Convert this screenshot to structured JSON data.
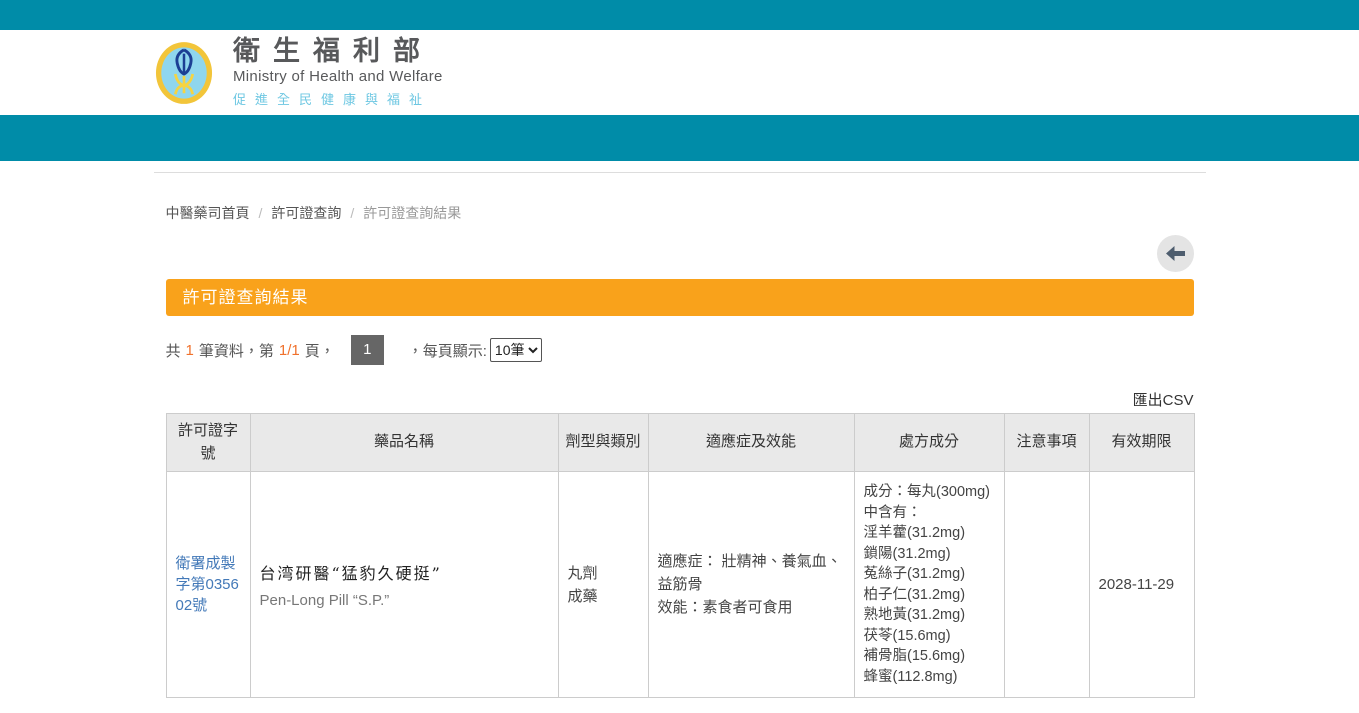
{
  "colors": {
    "teal": "#008CA8",
    "orange_bar": "#F9A21B",
    "accent_orange": "#F0712C",
    "link_blue": "#4379B8"
  },
  "header": {
    "title_zh": "衛生福利部",
    "title_en": "Ministry of Health and Welfare",
    "tagline": "促進全民健康與福祉"
  },
  "breadcrumb": {
    "separator": "/",
    "items": [
      {
        "label": "中醫藥司首頁"
      },
      {
        "label": "許可證查詢"
      },
      {
        "label": "許可證查詢結果"
      }
    ]
  },
  "page": {
    "section_title": "許可證查詢結果",
    "csv_label": "匯出CSV"
  },
  "pagination": {
    "prefix": "共",
    "total": "1",
    "mid1": "筆資料，第",
    "page_ratio": "1/1",
    "mid2": "頁，",
    "current_page": "1",
    "per_page_label": "，每頁顯示:",
    "per_page_value": "10筆"
  },
  "table": {
    "headers": {
      "license": "許可證字號",
      "drug_name": "藥品名稱",
      "dosage_type": "劑型與類別",
      "indications": "適應症及效能",
      "ingredients": "處方成分",
      "notes": "注意事項",
      "expiry": "有效期限"
    },
    "row": {
      "license_no": "衛署成製字第035602號",
      "drug_name_zh": "台湾研醫“猛豹久硬挺”",
      "drug_name_en": "Pen-Long Pill “S.P.”",
      "dosage_type": "丸劑\n成藥",
      "indications": "適應症： 壯精神、養氣血、益筋骨\n效能：素食者可食用",
      "ingredients": "成分：每丸(300mg)\n中含有：\n淫羊藿(31.2mg)\n鎖陽(31.2mg)\n菟絲子(31.2mg)\n柏子仁(31.2mg)\n熟地黃(31.2mg)\n茯苓(15.6mg)\n補骨脂(15.6mg)\n蜂蜜(112.8mg)",
      "notes": "",
      "expiry": "2028-11-29"
    }
  }
}
